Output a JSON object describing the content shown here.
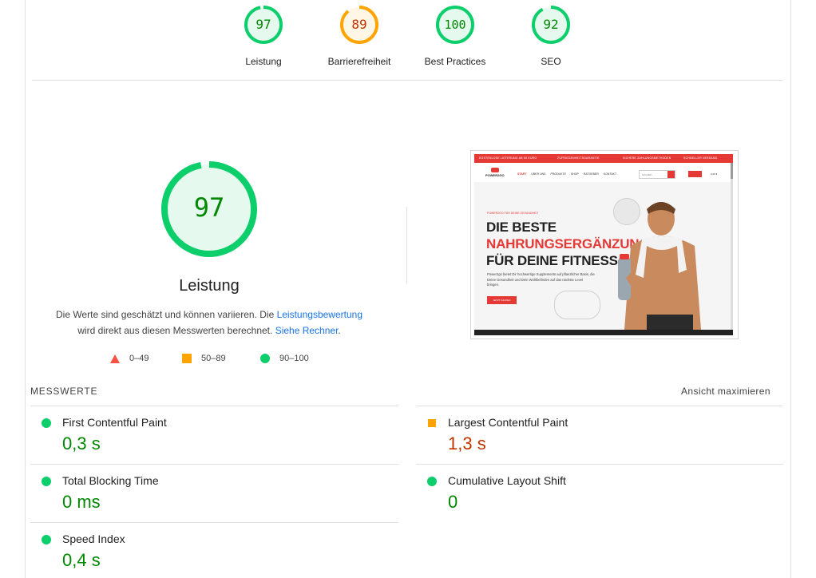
{
  "colors": {
    "pass": "#0cce6b",
    "pass_text": "#008800",
    "average": "#ffa400",
    "average_text": "#c33300",
    "fail": "#ff4e42",
    "link": "#1a73e8"
  },
  "gauges": [
    {
      "score": "97",
      "label": "Leistung",
      "status": "pass",
      "fraction": 0.97
    },
    {
      "score": "89",
      "label": "Barrierefreiheit",
      "status": "average",
      "fraction": 0.89
    },
    {
      "score": "100",
      "label": "Best Practices",
      "status": "pass",
      "fraction": 1.0
    },
    {
      "score": "92",
      "label": "SEO",
      "status": "pass",
      "fraction": 0.92
    }
  ],
  "performance": {
    "score": "97",
    "label": "Leistung",
    "fraction": 0.97,
    "desc_prefix": "Die Werte sind geschätzt und können variieren. Die ",
    "desc_link1": "Leistungsbewertung",
    "desc_middle": " wird direkt aus diesen Messwerten berechnet. ",
    "desc_link2": "Siehe Rechner",
    "desc_suffix": "."
  },
  "legend": [
    {
      "shape": "triangle-icon",
      "range": "0–49"
    },
    {
      "shape": "square-icon",
      "range": "50–89"
    },
    {
      "shape": "circle-icon",
      "range": "90–100"
    }
  ],
  "screenshot": {
    "topbar": [
      "KOSTENLOSE LIEFERUNG AB 50 EURO",
      "ZUFRIEDENHEITSGARANTIE",
      "SICHERE ZAHLUNGSMETHODEN",
      "SCHNELLER VERSAND"
    ],
    "logo": "POWER2GO",
    "nav_active": "START",
    "nav": [
      "ÜBER UNS",
      "PRODUKTE",
      "SHOP",
      "RATGEBER",
      "KONTAKT"
    ],
    "search_placeholder": "SUCHEN",
    "cart": "0,00 €",
    "eyebrow": "POWER2GO FÜR DEINE GESUNDHEIT",
    "headline_1": "DIE BESTE",
    "headline_2": "NAHRUNGSERGÄNZUNG",
    "headline_3": "FÜR DEINE FITNESS",
    "paragraph": "Power2go bietet Dir hochwertige Supplements auf pflanzlicher Basis, die Deine Gesundheit und Dein Wohlbefinden auf das nächste Level bringen.",
    "cta": "JETZT KAUFEN"
  },
  "metrics_header": "MESSWERTE",
  "expand_label": "Ansicht maximieren",
  "metrics": [
    {
      "name": "First Contentful Paint",
      "value": "0,3 s",
      "status": "pass"
    },
    {
      "name": "Largest Contentful Paint",
      "value": "1,3 s",
      "status": "average"
    },
    {
      "name": "Total Blocking Time",
      "value": "0 ms",
      "status": "pass"
    },
    {
      "name": "Cumulative Layout Shift",
      "value": "0",
      "status": "pass"
    },
    {
      "name": "Speed Index",
      "value": "0,4 s",
      "status": "pass"
    }
  ]
}
